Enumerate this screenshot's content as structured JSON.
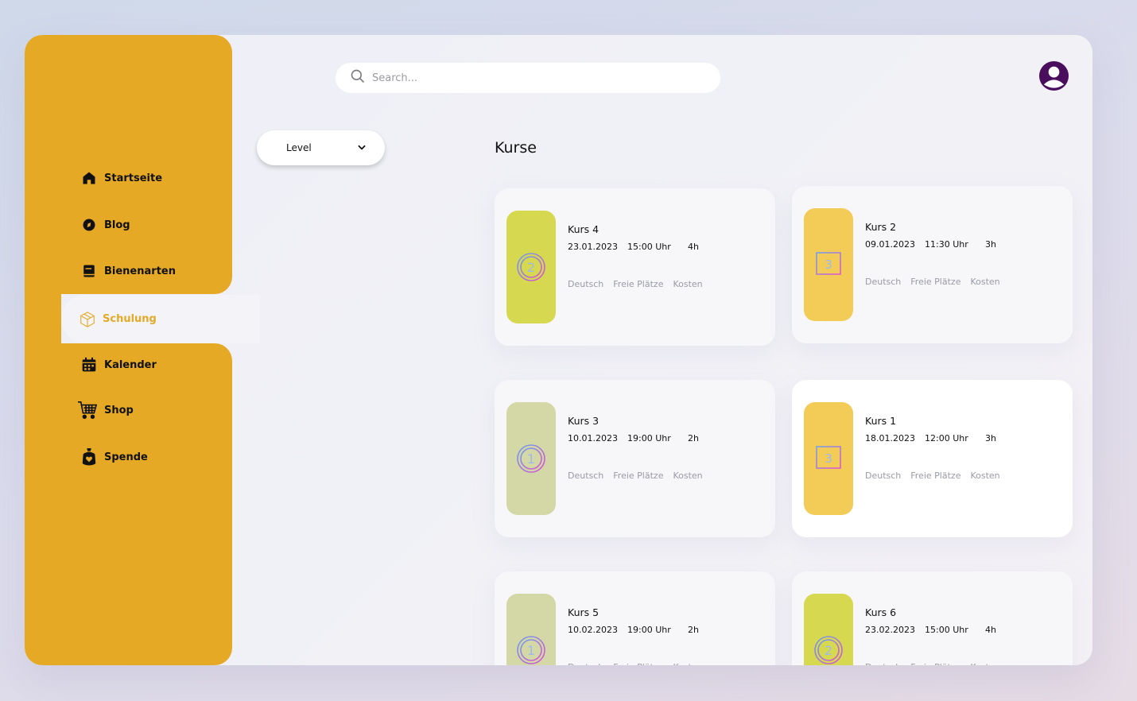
{
  "sidebar": {
    "items": [
      {
        "label": "Startseite",
        "icon": "home-icon"
      },
      {
        "label": "Blog",
        "icon": "blog-icon"
      },
      {
        "label": "Bienenarten",
        "icon": "book-icon"
      },
      {
        "label": "Schulung",
        "icon": "package-icon",
        "active": true
      },
      {
        "label": "Kalender",
        "icon": "calendar-icon"
      },
      {
        "label": "Shop",
        "icon": "cart-icon"
      },
      {
        "label": "Spende",
        "icon": "donation-icon"
      }
    ]
  },
  "search": {
    "placeholder": "Search..."
  },
  "filter": {
    "level_label": "Level"
  },
  "main": {
    "title": "Kurse",
    "courses": [
      {
        "name": "Kurs 4",
        "date": "23.01.2023",
        "time": "15:00 Uhr",
        "duration": "4h",
        "language": "Deutsch",
        "seats": "Freie Plätze",
        "cost": "Kosten",
        "level": "2",
        "color": "#d6d84f"
      },
      {
        "name": "Kurs 2",
        "date": "09.01.2023",
        "time": "11:30 Uhr",
        "duration": "3h",
        "language": "Deutsch",
        "seats": "Freie Plätze",
        "cost": "Kosten",
        "level": "3",
        "color": "#f2cc57"
      },
      {
        "name": "Kurs 3",
        "date": "10.01.2023",
        "time": "19:00 Uhr",
        "duration": "2h",
        "language": "Deutsch",
        "seats": "Freie Plätze",
        "cost": "Kosten",
        "level": "1",
        "color": "#d3d8a6"
      },
      {
        "name": "Kurs 1",
        "date": "18.01.2023",
        "time": "12:00 Uhr",
        "duration": "3h",
        "language": "Deutsch",
        "seats": "Freie Plätze",
        "cost": "Kosten",
        "level": "3",
        "color": "#f2cc57"
      },
      {
        "name": "Kurs 5",
        "date": "10.02.2023",
        "time": "19:00 Uhr",
        "duration": "2h",
        "language": "Deutsch",
        "seats": "Freie Plätze",
        "cost": "Kosten",
        "level": "1",
        "color": "#d3d8a6"
      },
      {
        "name": "Kurs 6",
        "date": "23.02.2023",
        "time": "15:00 Uhr",
        "duration": "4h",
        "language": "Deutsch",
        "seats": "Freie Plätze",
        "cost": "Kosten",
        "level": "2",
        "color": "#d6d84f"
      }
    ]
  },
  "colors": {
    "accent": "#e5a926",
    "avatar": "#4a0f5c"
  }
}
